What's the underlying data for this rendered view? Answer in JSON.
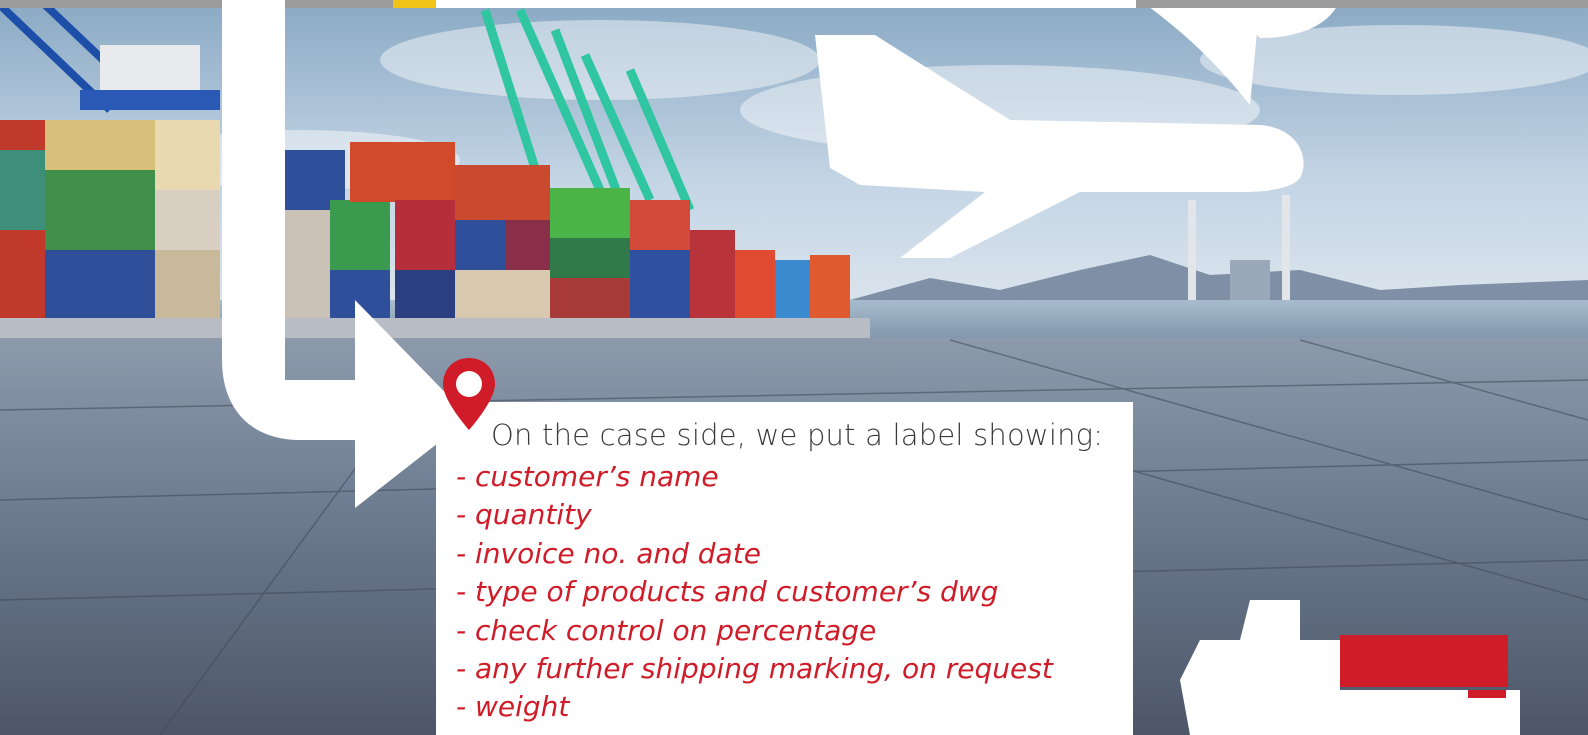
{
  "colors": {
    "accent_red": "#d01c28",
    "text_gray": "#3a3a3a",
    "card_bg": "#ffffff",
    "sky": "#bcd0e3",
    "pavement": "#6f7e92"
  },
  "icons": {
    "pin": "location-pin-icon",
    "plane": "airplane-icon",
    "ship": "ship-icon",
    "arrow": "flow-arrow-icon"
  },
  "card": {
    "heading": "On the case side, we put a label showing:",
    "items": [
      "- customer’s name",
      "- quantity",
      "- invoice no. and date",
      "- type of products and customer’s dwg",
      "- check control on percentage",
      "- any further shipping marking, on request",
      "- weight"
    ]
  }
}
